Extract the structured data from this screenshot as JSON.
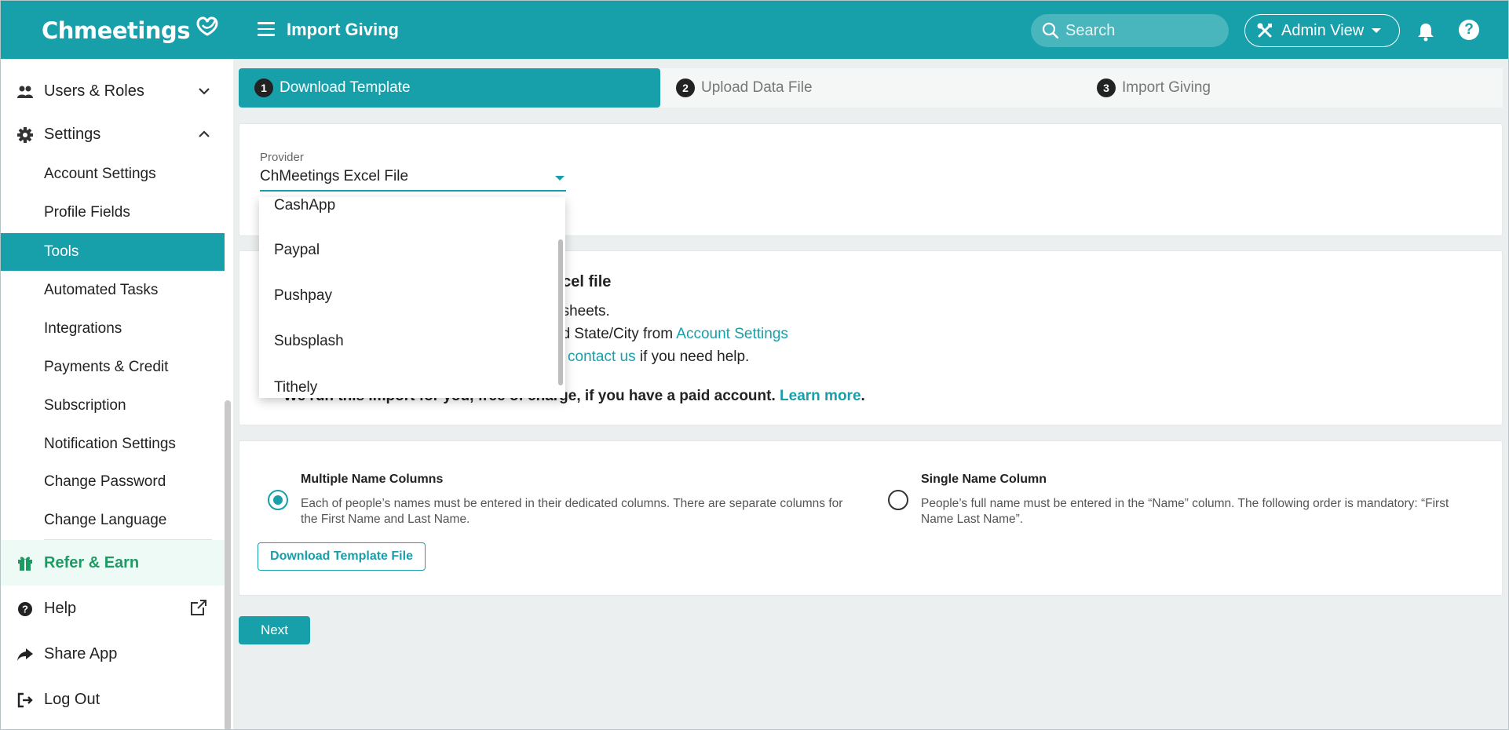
{
  "app": {
    "brand": "Chmeetings",
    "page_title": "Import Giving",
    "search_placeholder": "Search",
    "admin_view_label": "Admin View",
    "help_symbol": "?"
  },
  "colors": {
    "primary": "#17a0aa",
    "refer_green": "#1e9a63"
  },
  "sidebar": {
    "users_roles": "Users & Roles",
    "settings": "Settings",
    "sub_items": [
      "Account Settings",
      "Profile Fields",
      "Tools",
      "Automated Tasks",
      "Integrations",
      "Payments & Credit",
      "Subscription",
      "Notification Settings",
      "Change Password",
      "Change Language"
    ],
    "active_item": "Tools",
    "refer_earn": "Refer & Earn",
    "help": "Help",
    "share_app": "Share App",
    "log_out": "Log Out"
  },
  "steps": [
    {
      "number": "1",
      "label": "Download Template"
    },
    {
      "number": "2",
      "label": "Upload Data File"
    },
    {
      "number": "3",
      "label": "Import Giving"
    }
  ],
  "provider": {
    "label": "Provider",
    "selected": "ChMeetings Excel File",
    "options": [
      "CashApp",
      "Paypal",
      "Pushpay",
      "Subsplash",
      "Tithely"
    ]
  },
  "info": {
    "title_fragment": "xcel file",
    "line1_fragment": "dsheets.",
    "line2_fragment": "nd State/City from ",
    "line2_link": "Account Settings",
    "line3_link": "contact us",
    "line3_rest": " if you need help.",
    "bold_fragment": "We run this import for you, free of charge, if you have a paid account. ",
    "learn_more": "Learn more",
    "period": "."
  },
  "name_options": {
    "multiple": {
      "title": "Multiple Name Columns",
      "desc": "Each of people’s names must be entered in their dedicated columns. There are separate columns for the First Name and Last Name.",
      "selected": true
    },
    "single": {
      "title": "Single Name Column",
      "desc": "People’s full name must be entered in the “Name” column. The following order is mandatory: “First Name Last Name”.",
      "selected": false
    }
  },
  "buttons": {
    "download_template": "Download Template File",
    "next": "Next"
  }
}
